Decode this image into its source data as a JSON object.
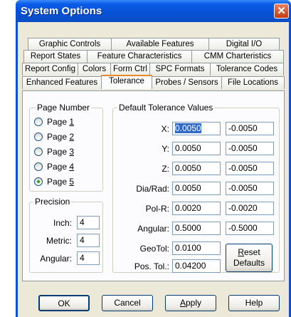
{
  "window": {
    "title": "System Options",
    "close_label": "✕"
  },
  "tabs": {
    "row1": [
      "Graphic Controls",
      "Available Features",
      "Digital I/O"
    ],
    "row2": [
      "Report States",
      "Feature Characteristics",
      "CMM Charteristics"
    ],
    "row3": [
      "Report Config",
      "Colors",
      "Form Ctrl",
      "SPC Formats",
      "Tolerance Codes"
    ],
    "row4": [
      "Enhanced Features",
      "Tolerance",
      "Probes / Sensors",
      "File Locations"
    ],
    "active": "Tolerance"
  },
  "page_number": {
    "legend": "Page Number",
    "pages": [
      {
        "prefix": "Page ",
        "key": "1",
        "checked": false
      },
      {
        "prefix": "Page ",
        "key": "2",
        "checked": false
      },
      {
        "prefix": "Page ",
        "key": "3",
        "checked": false
      },
      {
        "prefix": "Page ",
        "key": "4",
        "checked": false
      },
      {
        "prefix": "Page ",
        "key": "5",
        "checked": true
      }
    ]
  },
  "precision": {
    "legend": "Precision",
    "rows": [
      {
        "label": "Inch:",
        "value": "4"
      },
      {
        "label": "Metric:",
        "value": "4"
      },
      {
        "label": "Angular:",
        "value": "4"
      }
    ]
  },
  "default_tolerance": {
    "legend": "Default Tolerance Values",
    "rows": [
      {
        "label": "X:",
        "plus": "0.0050",
        "minus": "-0.0050"
      },
      {
        "label": "Y:",
        "plus": "0.0050",
        "minus": "-0.0050"
      },
      {
        "label": "Z:",
        "plus": "0.0050",
        "minus": "-0.0050"
      },
      {
        "label": "Dia/Rad:",
        "plus": "0.0050",
        "minus": "-0.0050"
      },
      {
        "label": "Pol-R:",
        "plus": "0.0020",
        "minus": "-0.0020"
      },
      {
        "label": "Angular:",
        "plus": "0.5000",
        "minus": "-0.5000"
      }
    ],
    "geotol": {
      "label": "GeoTol:",
      "value": "0.0100"
    },
    "postol": {
      "label": "Pos. Tol.:",
      "value": "0.04200"
    },
    "reset": {
      "line1_key": "R",
      "line1_rest": "eset",
      "line2": "Defaults"
    }
  },
  "buttons": {
    "ok": "OK",
    "cancel": "Cancel",
    "apply_key": "A",
    "apply_rest": "pply",
    "help": "Help"
  },
  "colors": {
    "titlebar": "#0651d5",
    "selection": "#316ac5",
    "active_tab_accent": "#e68b2c"
  }
}
